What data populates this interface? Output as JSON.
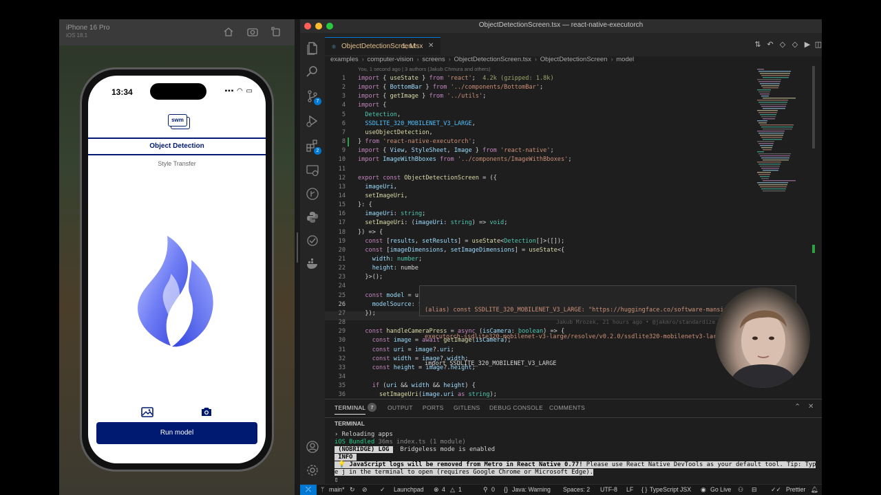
{
  "simulator": {
    "device": "iPhone 16 Pro",
    "os": "iOS 18.1",
    "status_time": "13:34",
    "logo_text": "swm",
    "tabs": {
      "active": "Object Detection",
      "inactive": "Style Transfer"
    },
    "run_button": "Run model"
  },
  "vscode": {
    "window_title": "ObjectDetectionScreen.tsx — react-native-executorch",
    "tab": {
      "file": "ObjectDetectionScreen.tsx",
      "status": "1, M"
    },
    "breadcrumbs": [
      "examples",
      "computer-vision",
      "screens",
      "ObjectDetectionScreen.tsx",
      "ObjectDetectionScreen",
      "model"
    ],
    "blame_top": "You, 1 second ago | 3 authors (Jakub Chmura and others)",
    "activity_badges": {
      "source_control": "7",
      "extensions": "2"
    },
    "code_lines": [
      {
        "n": "1",
        "t": "import { useState } from 'react';  4.2k (gzipped: 1.8k)"
      },
      {
        "n": "2",
        "t": "import { BottomBar } from '../components/BottomBar';"
      },
      {
        "n": "3",
        "t": "import { getImage } from '../utils';"
      },
      {
        "n": "4",
        "t": "import {"
      },
      {
        "n": "5",
        "t": "  Detection,"
      },
      {
        "n": "6",
        "t": "  SSDLITE_320_MOBILENET_V3_LARGE,"
      },
      {
        "n": "7",
        "t": "  useObjectDetection,"
      },
      {
        "n": "8",
        "t": "} from 'react-native-executorch';"
      },
      {
        "n": "9",
        "t": "import { View, StyleSheet, Image } from 'react-native';"
      },
      {
        "n": "10",
        "t": "import ImageWithBboxes from '../components/ImageWithBboxes';"
      },
      {
        "n": "11",
        "t": ""
      },
      {
        "n": "12",
        "t": "export const ObjectDetectionScreen = ({"
      },
      {
        "n": "13",
        "t": "  imageUri,"
      },
      {
        "n": "14",
        "t": "  setImageUri,"
      },
      {
        "n": "15",
        "t": "}: {"
      },
      {
        "n": "16",
        "t": "  imageUri: string;"
      },
      {
        "n": "17",
        "t": "  setImageUri: (imageUri: string) => void;"
      },
      {
        "n": "18",
        "t": "}) => {"
      },
      {
        "n": "19",
        "t": "  const [results, setResults] = useState<Detection[]>([]);"
      },
      {
        "n": "20",
        "t": "  const [imageDimensions, setImageDimensions] = useState<{"
      },
      {
        "n": "21",
        "t": "    width: number;"
      },
      {
        "n": "22",
        "t": "    height: numbe"
      },
      {
        "n": "23",
        "t": "  }>();"
      },
      {
        "n": "24",
        "t": ""
      },
      {
        "n": "25",
        "t": "  const model = u"
      },
      {
        "n": "26",
        "t": "    modelSource: SSDLITE_320_MOBILENET_V3_LARGE,"
      },
      {
        "n": "27",
        "t": "  });"
      },
      {
        "n": "28",
        "t": ""
      },
      {
        "n": "29",
        "t": "  const handleCameraPress = async (isCamera: boolean) => {"
      },
      {
        "n": "30",
        "t": "    const image = await getImage(isCamera);"
      },
      {
        "n": "31",
        "t": "    const uri = image?.uri;"
      },
      {
        "n": "32",
        "t": "    const width = image?.width;"
      },
      {
        "n": "33",
        "t": "    const height = image?.height;"
      },
      {
        "n": "34",
        "t": ""
      },
      {
        "n": "35",
        "t": "    if (uri && width && height) {"
      },
      {
        "n": "36",
        "t": "      setImageUri(image.uri as string);"
      }
    ],
    "hover": {
      "line1": "(alias) const SSDLITE_320_MOBILENET_V3_LARGE: \"https://huggingface.co/software-mansion/react-native-",
      "line2": "executorch-ssdlite320-mobilenet-v3-large/resolve/v0.2.0/ssdlite320-mobilenetv3-large.pte\"",
      "line3": "import SSDLITE_320_MOBILENET_V3_LARGE"
    },
    "blame_inline": "Jakub Mrozek, 21 hours ago • @jakmro/standardize",
    "panel": {
      "tabs": [
        "TERMINAL",
        "OUTPUT",
        "PORTS",
        "GITLENS",
        "DEBUG CONSOLE",
        "COMMENTS"
      ],
      "terminal_badge": "7",
      "terminal_header": "TERMINAL",
      "lines": {
        "l1": "› Reloading apps",
        "l2a": "iOS Bundled",
        "l2b": " 36ms index.ts (1 module)",
        "l3a": " (NOBRIDGE) LOG ",
        "l3b": "  Bridgeless mode is enabled",
        "l4": " INFO ",
        "l5a": " 💡 JavaScript logs will be removed from Metro in React Native 0.77!",
        "l5b": " Please use React Native DevTools as your default tool. Tip: Typ",
        "l6": "e j in the terminal to open (requires Google Chrome or Microsoft Edge).",
        "l7": "▯"
      }
    },
    "status": {
      "branch": "main*",
      "launchpad": "Launchpad",
      "errors": "4",
      "warnings": "1",
      "ports": "0",
      "java": "Java: Warning",
      "spaces": "Spaces: 2",
      "encoding": "UTF-8",
      "eol": "LF",
      "language": "TypeScript JSX",
      "golive": "Go Live",
      "prettier": "Prettier"
    }
  },
  "colors": {
    "brand_navy": "#001a72",
    "accent_blue": "#0078d4"
  }
}
